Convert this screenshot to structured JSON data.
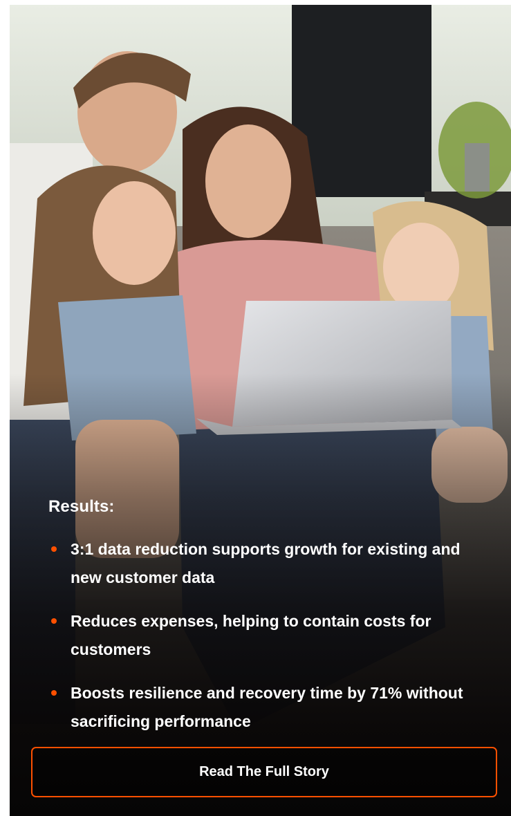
{
  "image": {
    "description_icon": "family-laptop-photo"
  },
  "results": {
    "heading": "Results:",
    "items": [
      {
        "text": "3:1 data reduction supports growth for existing and new customer data"
      },
      {
        "text": "Reduces expenses, helping to contain costs for customers"
      },
      {
        "text": "Boosts resilience and recovery time by 71% without sacrificing performance"
      }
    ]
  },
  "cta": {
    "label": "Read The Full Story"
  },
  "colors": {
    "accent": "#fe5000",
    "text": "#ffffff",
    "background": "#0e0b0a"
  }
}
